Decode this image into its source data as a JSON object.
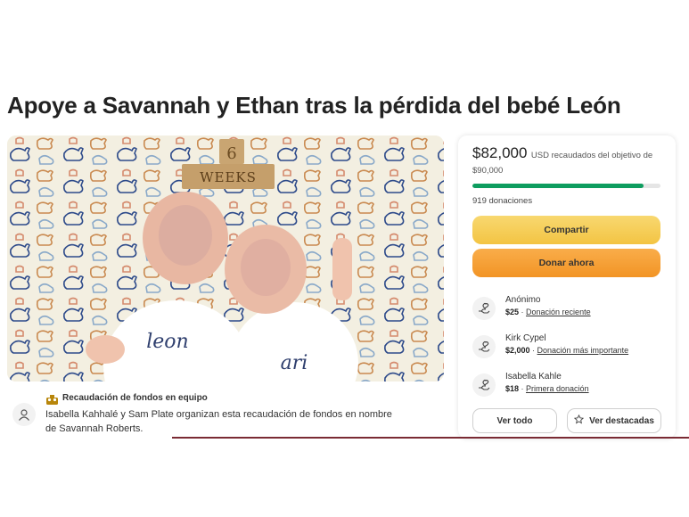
{
  "title": "Apoye a Savannah y Ethan tras la pérdida del bebé León",
  "hero": {
    "sign_number": "6",
    "sign_text": "WEEKS",
    "onesie_left": "leon",
    "onesie_right": "ari"
  },
  "team": {
    "label": "Recaudación de fondos en equipo",
    "organizer_text": "Isabella Kahhalé y Sam Plate organizan esta recaudación de fondos en nombre de Savannah Roberts."
  },
  "card": {
    "raised_amount": "$82,000",
    "raised_rest": "USD recaudados del objetivo de $90,000",
    "progress_fraction": 0.91,
    "donations_count": "919 donaciones",
    "share_label": "Compartir",
    "donate_label": "Donar ahora",
    "donors": [
      {
        "name": "Anónimo",
        "amount": "$25",
        "tag": "Donación reciente"
      },
      {
        "name": "Kirk Cypel",
        "amount": "$2,000",
        "tag": "Donación más importante"
      },
      {
        "name": "Isabella Kahle",
        "amount": "$18",
        "tag": "Primera donación"
      }
    ],
    "see_all_label": "Ver todo",
    "see_featured_label": "Ver destacadas"
  },
  "colors": {
    "progress": "#0e9d5f",
    "share_button": "#f5ca4f",
    "donate_button": "#f59e31",
    "accent_line": "#7a2b34"
  }
}
